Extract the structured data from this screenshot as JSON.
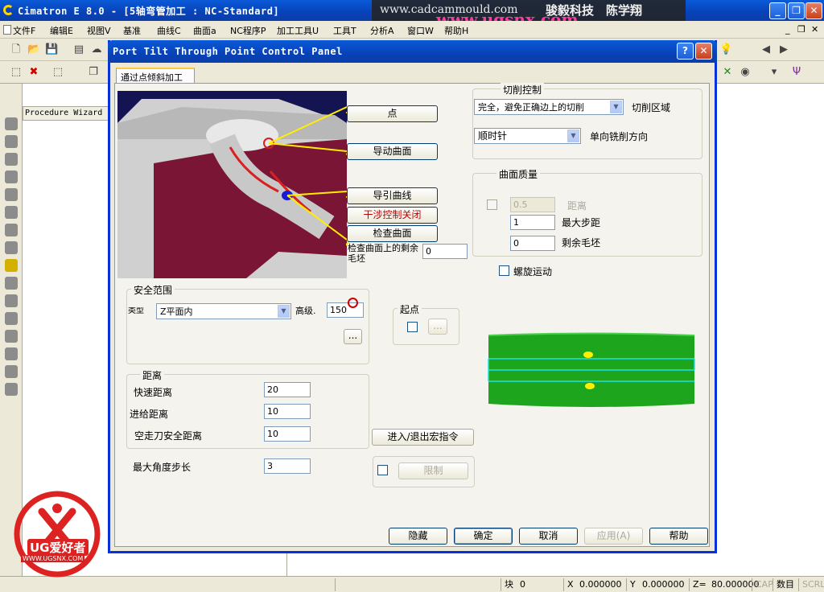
{
  "app": {
    "title": "Cimatron E 8.0 - [5轴弯管加工 : NC-Standard]",
    "watermark_line1": "www.cadcammould.com",
    "watermark_line1_right": "骏毅科技　陈学翔",
    "watermark_line2": "www.ugsnx.com",
    "logo_text": "UG爱好者",
    "logo_url": "WWW.UGSNX.COM"
  },
  "window_buttons": {
    "minimize": "_",
    "restore": "❐",
    "close": "✕"
  },
  "menu": [
    "文件F",
    "编辑E",
    "视图V",
    "基准",
    "曲线C",
    "曲面a",
    "NC程序P",
    "加工工具U",
    "工具T",
    "分析A",
    "窗口W",
    "帮助H"
  ],
  "menu_right": {
    "minimize": "_",
    "restore": "❐",
    "close": "✕"
  },
  "procedure_wizard": "Procedure Wizard",
  "status": {
    "block_label": "块",
    "block_value": "0",
    "x_label": "X",
    "x_value": "0.000000",
    "y_label": "Y",
    "y_value": "0.000000",
    "z_label": "Z=",
    "z_value": "80.000000",
    "cap": "CAP",
    "num": "数目",
    "scrl": "SCRL"
  },
  "dialog": {
    "title": "Port Tilt Through Point Control Panel",
    "help_btn": "?",
    "close_btn": "✕",
    "tab": "通过点倾斜加工",
    "buttons": {
      "point": "点",
      "drive_surface": "导动曲面",
      "guide_curve": "导引曲线",
      "interference": "干涉控制关闭",
      "check_surface": "检查曲面"
    },
    "check_surface_stock_label": "检查曲面上的剩余毛坯",
    "check_surface_stock_value": "0",
    "cut_control": {
      "group_label": "切削控制",
      "cut_mode_value": "完全，避免正确边上的切削",
      "cut_mode_label": "切削区域",
      "direction_value": "顺时针",
      "direction_label": "单向铣削方向"
    },
    "surface_quality": {
      "group_label": "曲面质量",
      "distance_value": "0.5",
      "distance_label": "距离",
      "max_step_value": "1",
      "max_step_label": "最大步距",
      "stock_value": "0",
      "stock_label": "剩余毛坯"
    },
    "spiral_label": "螺旋运动",
    "safety": {
      "group_label": "安全范围",
      "type_label": "类型",
      "type_value": "Z平面内",
      "height_label": "高级.",
      "height_value": "150",
      "ellipsis": "..."
    },
    "start_point": {
      "group_label": "起点",
      "ellipsis": "..."
    },
    "distance": {
      "group_label": "距离",
      "rapid_label": "快速距离",
      "rapid_value": "20",
      "feed_label": "进给距离",
      "feed_value": "10",
      "air_label": "空走刀安全距离",
      "air_value": "10"
    },
    "macro_button": "进入/退出宏指令",
    "max_angle_label": "最大角度步长",
    "max_angle_value": "3",
    "limit_button": "限制",
    "footer": {
      "hide": "隐藏",
      "ok": "确定",
      "cancel": "取消",
      "apply": "应用(A)",
      "help": "帮助"
    }
  },
  "colors": {
    "titlebar": "#0842b8",
    "dialog_border": "#0831d9",
    "face": "#ece9d8",
    "preview_bg": "#1a1a66",
    "part_red": "#7a1535",
    "yellow_line": "#ffee00",
    "green_surface": "#18a018"
  }
}
